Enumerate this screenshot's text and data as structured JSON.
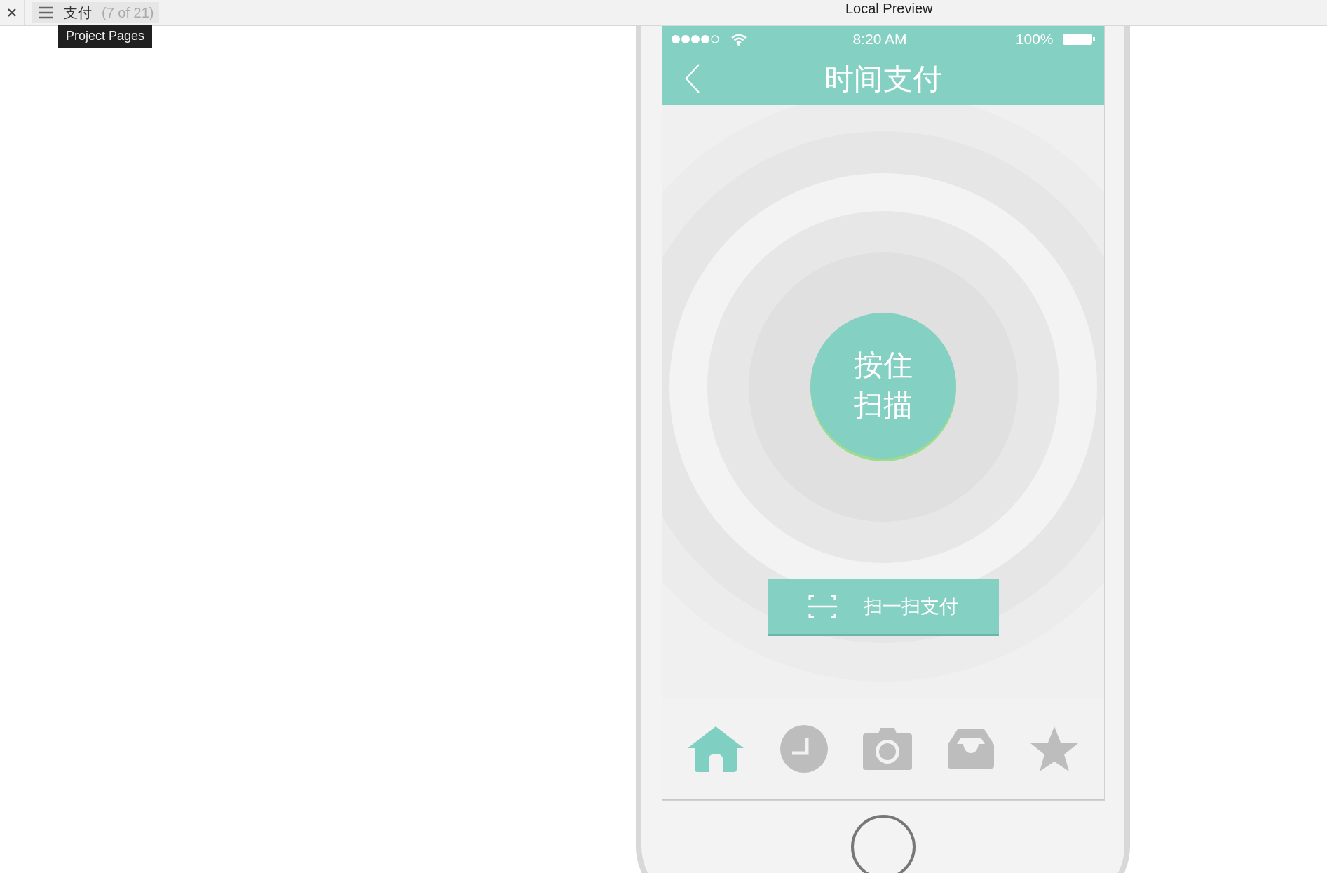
{
  "toolbar": {
    "page_title": "支付",
    "page_counter": "(7 of 21)",
    "window_title": "Local Preview",
    "tooltip": "Project Pages"
  },
  "status_bar": {
    "time": "8:20 AM",
    "battery": "100%"
  },
  "nav_bar": {
    "title": "时间支付"
  },
  "hold_button": {
    "lines": [
      "按住",
      "扫描"
    ]
  },
  "scan_button": {
    "label": "扫一扫支付"
  },
  "tab_bar": [
    {
      "kind": "home",
      "selected": true
    },
    {
      "kind": "clock",
      "selected": false
    },
    {
      "kind": "camera",
      "selected": false
    },
    {
      "kind": "inbox",
      "selected": false
    },
    {
      "kind": "star",
      "selected": false
    }
  ]
}
